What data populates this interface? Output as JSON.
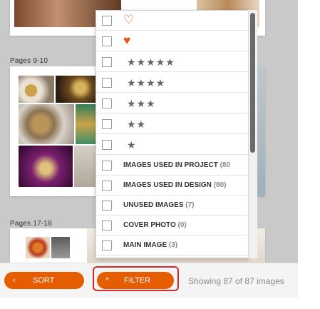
{
  "pages": {
    "spread_a_label": "Pages 9-10",
    "spread_b_label": "Pages 17-18"
  },
  "filter_menu": {
    "heart_outline_icon": "heart-outline-icon",
    "heart_filled_icon": "heart-filled-icon",
    "stars": [
      "★★★★★",
      "★★★★",
      "★★★",
      "★★",
      "★"
    ],
    "items": [
      {
        "label": "IMAGES USED IN PROJECT",
        "count": "(80"
      },
      {
        "label": "IMAGES USED IN DESIGN",
        "count": "(80)"
      },
      {
        "label": "UNUSED IMAGES",
        "count": "(7)"
      },
      {
        "label": "COVER PHOTO",
        "count": "(0)"
      },
      {
        "label": "MAIN IMAGE",
        "count": "(3)"
      }
    ]
  },
  "toolbar": {
    "sort_chevron": "‹",
    "sort_label": "SORT",
    "filter_chevron": "^",
    "filter_label": "FILTER",
    "status": "Showing 87 of 87 images"
  },
  "colors": {
    "accent": "#e65c00",
    "focus": "#d32a2a",
    "heart": "#e0531d"
  }
}
